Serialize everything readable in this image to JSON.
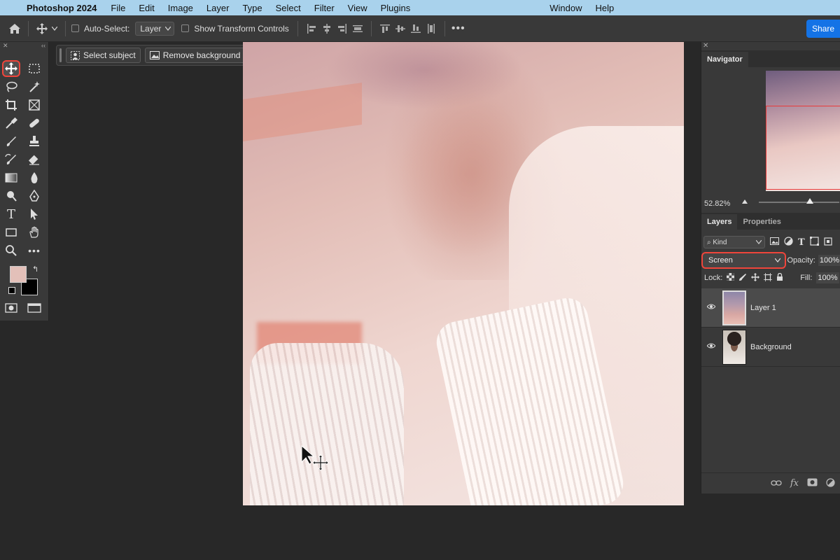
{
  "menubar": {
    "app_name": "Photoshop 2024",
    "items": [
      "File",
      "Edit",
      "Image",
      "Layer",
      "Type",
      "Select",
      "Filter",
      "View",
      "Plugins"
    ],
    "right_items": [
      "Window",
      "Help"
    ]
  },
  "options_bar": {
    "auto_select_label": "Auto-Select:",
    "auto_select_value": "Layer",
    "show_transform_label": "Show Transform Controls",
    "share_label": "Share"
  },
  "task_bar": {
    "select_subject_label": "Select subject",
    "remove_background_label": "Remove background"
  },
  "navigator": {
    "tab_label": "Navigator",
    "zoom": "52.82%"
  },
  "layers_panel": {
    "tabs": [
      "Layers",
      "Properties"
    ],
    "filter_kind": "Kind",
    "blend_mode": "Screen",
    "opacity_label": "Opacity:",
    "opacity_value": "100%",
    "lock_label": "Lock:",
    "fill_label": "Fill:",
    "fill_value": "100%",
    "layers": [
      {
        "name": "Layer 1",
        "selected": true
      },
      {
        "name": "Background",
        "selected": false
      }
    ]
  },
  "colors": {
    "foreground": "#e3c0b9",
    "background": "#000000",
    "highlight": "#f0453b",
    "share_button": "#1473e6"
  },
  "tool_icons": [
    "move-tool-icon",
    "marquee-tool-icon",
    "lasso-tool-icon",
    "magic-wand-icon",
    "crop-tool-icon",
    "frame-tool-icon",
    "eyedropper-icon",
    "healing-brush-icon",
    "brush-icon",
    "stamp-icon",
    "history-brush-icon",
    "eraser-icon",
    "gradient-icon",
    "blur-icon",
    "dodge-icon",
    "pen-icon",
    "type-icon",
    "path-select-icon",
    "rectangle-icon",
    "hand-icon",
    "zoom-icon",
    "more-tools-icon"
  ]
}
